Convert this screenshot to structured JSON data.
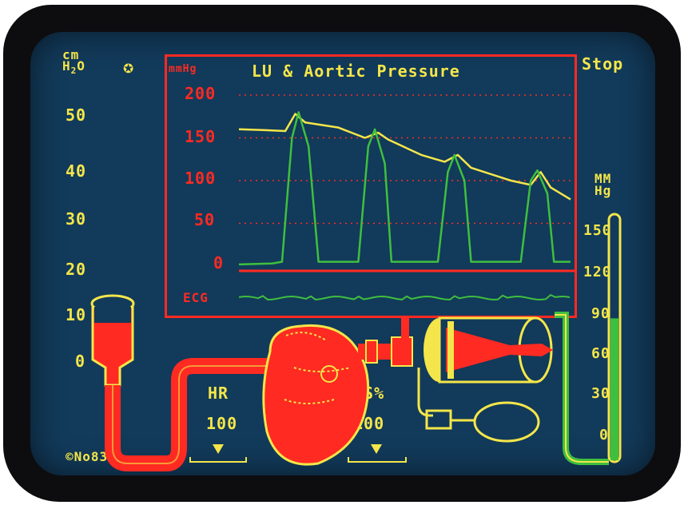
{
  "left_gauge": {
    "unit_line1": "cm",
    "unit_line2": "H",
    "unit_sub": "2",
    "unit_line2_tail": "O",
    "star_icon": "star-icon",
    "ticks": [
      "50",
      "40",
      "30",
      "20",
      "10",
      "0"
    ]
  },
  "chart": {
    "title": "LU & Aortic Pressure",
    "y_unit": "mmHg",
    "y_ticks": [
      "200",
      "150",
      "100",
      "50",
      "0"
    ],
    "ecg_label": "ECG"
  },
  "stop_label": "Stop",
  "right_gauge": {
    "unit_line1": "MM",
    "unit_line2": "Hg",
    "ticks": [
      "150",
      "120",
      "90",
      "60",
      "30",
      "0"
    ],
    "level_value": 90,
    "max_value": 150
  },
  "hr": {
    "label": "HR",
    "value": "100"
  },
  "is": {
    "label": "IS%",
    "value": "100"
  },
  "copyright": "©No83",
  "colors": {
    "screen": "#123a5a",
    "yellow": "#f4e64a",
    "red": "#ff2a22",
    "green": "#3fbf3f"
  },
  "chart_data": {
    "type": "line",
    "title": "LU & Aortic Pressure",
    "ylabel": "mmHg",
    "ylim": [
      0,
      200
    ],
    "series": [
      {
        "values_xy": [
          [
            0,
            160
          ],
          [
            0.08,
            159
          ],
          [
            0.14,
            158
          ],
          [
            0.17,
            178
          ],
          [
            0.2,
            168
          ],
          [
            0.3,
            162
          ],
          [
            0.38,
            150
          ],
          [
            0.42,
            156
          ],
          [
            0.45,
            148
          ],
          [
            0.55,
            130
          ],
          [
            0.62,
            122
          ],
          [
            0.66,
            130
          ],
          [
            0.7,
            115
          ],
          [
            0.82,
            100
          ],
          [
            0.88,
            95
          ],
          [
            0.91,
            110
          ],
          [
            0.94,
            92
          ],
          [
            1.0,
            78
          ]
        ]
      },
      {
        "values_xy": [
          [
            0,
            2
          ],
          [
            0.1,
            3
          ],
          [
            0.13,
            5
          ],
          [
            0.16,
            150
          ],
          [
            0.18,
            180
          ],
          [
            0.21,
            140
          ],
          [
            0.24,
            5
          ],
          [
            0.36,
            5
          ],
          [
            0.39,
            140
          ],
          [
            0.41,
            160
          ],
          [
            0.44,
            120
          ],
          [
            0.46,
            5
          ],
          [
            0.6,
            5
          ],
          [
            0.63,
            110
          ],
          [
            0.65,
            130
          ],
          [
            0.68,
            100
          ],
          [
            0.7,
            5
          ],
          [
            0.85,
            5
          ],
          [
            0.88,
            100
          ],
          [
            0.9,
            112
          ],
          [
            0.93,
            85
          ],
          [
            0.95,
            5
          ],
          [
            1.0,
            5
          ]
        ]
      }
    ]
  }
}
